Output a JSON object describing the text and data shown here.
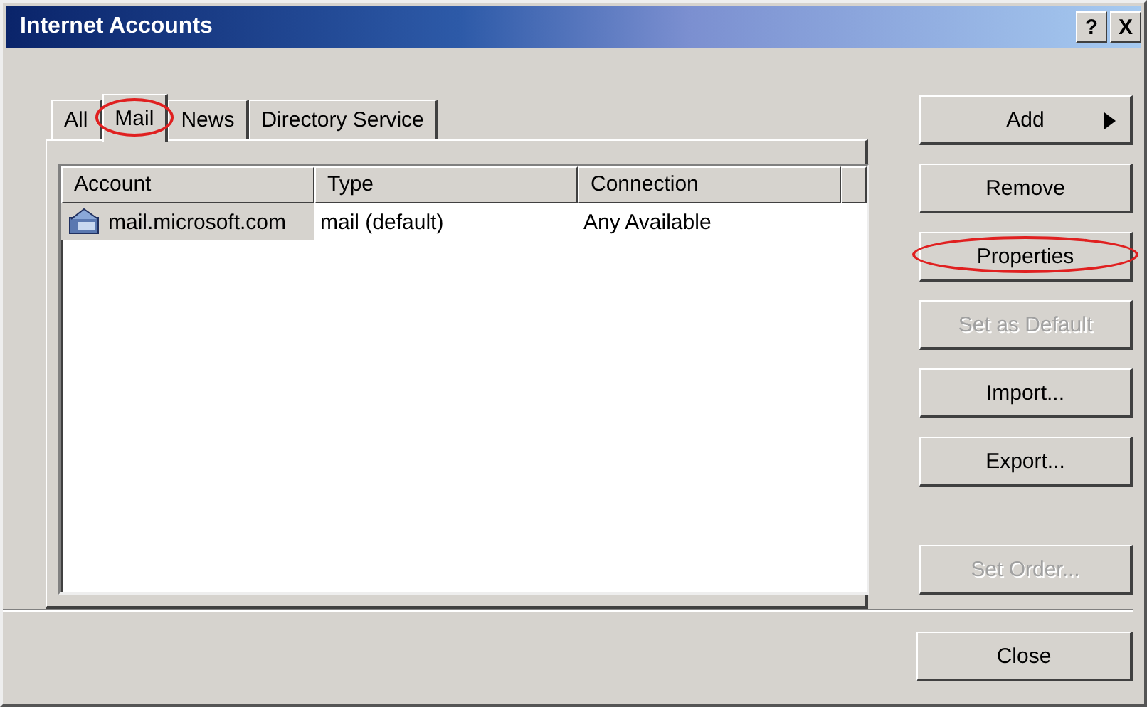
{
  "window": {
    "title": "Internet Accounts",
    "title_buttons": [
      "?",
      "X"
    ]
  },
  "tabs": [
    {
      "label": "All",
      "selected": false,
      "highlighted": false
    },
    {
      "label": "Mail",
      "selected": true,
      "highlighted": true
    },
    {
      "label": "News",
      "selected": false,
      "highlighted": false
    },
    {
      "label": "Directory Service",
      "selected": false,
      "highlighted": false
    }
  ],
  "table": {
    "columns": [
      "Account",
      "Type",
      "Connection"
    ],
    "rows": [
      {
        "cells": [
          "mail.microsoft.com",
          "mail (default)",
          "Any Available"
        ],
        "selected": true
      }
    ]
  },
  "buttons": [
    {
      "label": "Add",
      "kind": "menu",
      "disabled": false,
      "highlighted": false
    },
    {
      "label": "Remove",
      "kind": "plain",
      "disabled": false,
      "highlighted": false
    },
    {
      "label": "Properties",
      "kind": "plain",
      "disabled": false,
      "highlighted": true
    },
    {
      "label": "Set as Default",
      "kind": "plain",
      "disabled": true,
      "highlighted": false
    },
    {
      "label": "Import...",
      "kind": "plain",
      "disabled": false,
      "highlighted": false
    },
    {
      "label": "Export...",
      "kind": "plain",
      "disabled": false,
      "highlighted": false
    }
  ],
  "lower_buttons": [
    {
      "label": "Set Order...",
      "disabled": true,
      "highlighted": false
    }
  ],
  "close_button": {
    "label": "Close"
  }
}
